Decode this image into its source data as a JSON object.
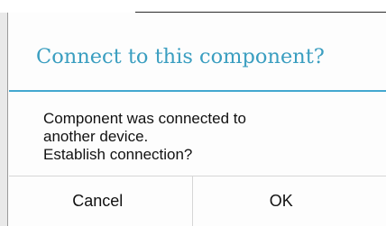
{
  "dialog": {
    "title": "Connect to this component?",
    "message_lines": [
      "Component was connected to",
      "another device.",
      "Establish connection?"
    ],
    "cancel_label": "Cancel",
    "ok_label": "OK"
  },
  "colors": {
    "title": "#3a9ec0",
    "divider": "#43a8d0",
    "dialog_background": "#fdfdfd",
    "text": "#111111"
  }
}
